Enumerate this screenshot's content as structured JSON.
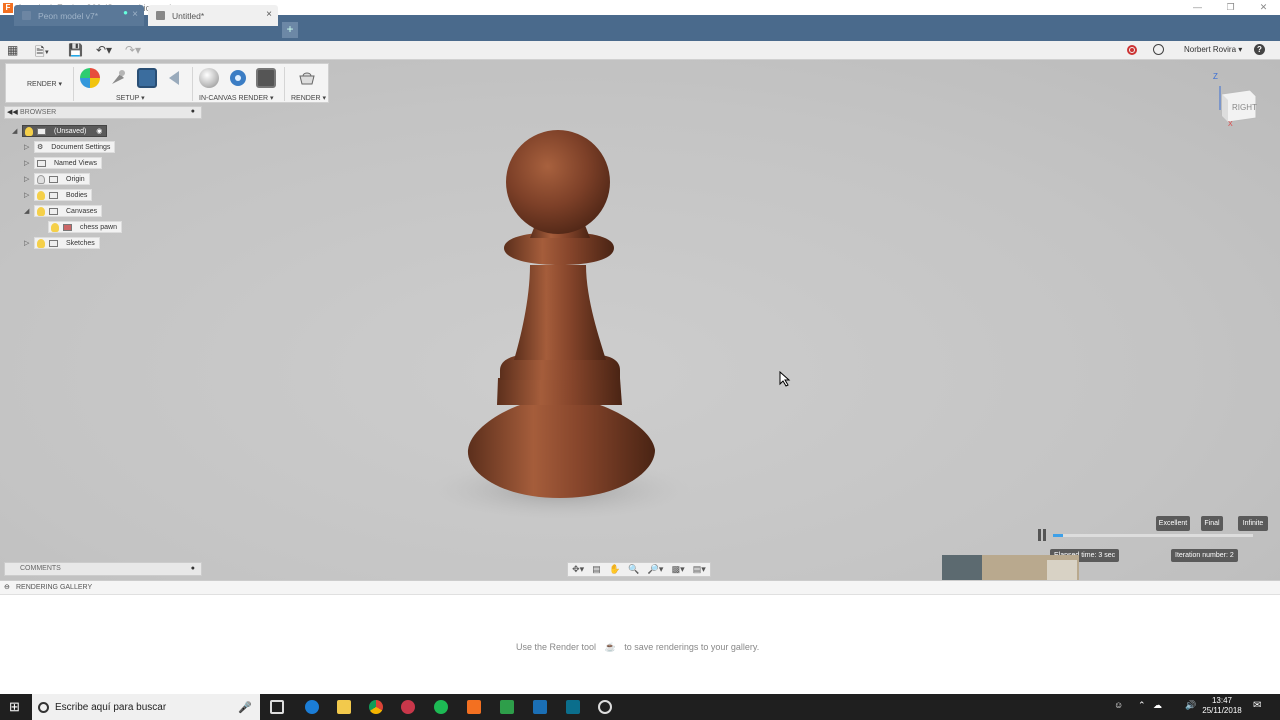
{
  "window": {
    "title": "Autodesk Fusion 360 (Startup License)"
  },
  "tabs": [
    {
      "label": "Peon model v7*"
    },
    {
      "label": "Untitled*"
    }
  ],
  "user": {
    "name": "Norbert Rovira"
  },
  "toolbar": {
    "render_mode": "RENDER",
    "groups": [
      {
        "label": "SETUP"
      },
      {
        "label": "IN-CANVAS RENDER"
      },
      {
        "label": "RENDER"
      }
    ]
  },
  "browser": {
    "title": "BROWSER",
    "root": "(Unsaved)",
    "items": [
      {
        "label": "Document Settings"
      },
      {
        "label": "Named Views"
      },
      {
        "label": "Origin"
      },
      {
        "label": "Bodies"
      },
      {
        "label": "Canvases"
      },
      {
        "label": "chess pawn"
      },
      {
        "label": "Sketches"
      }
    ]
  },
  "viewcube": {
    "face": "RIGHT",
    "axis_z": "Z",
    "axis_x": "X"
  },
  "comments": {
    "title": "COMMENTS"
  },
  "quality": {
    "options": [
      "Excellent",
      "Final",
      "Infinite"
    ],
    "elapsed": "Elapsed time: 3 sec",
    "iteration": "Iteration number: 2",
    "progress": 0.05
  },
  "gallery": {
    "title": "RENDERING GALLERY",
    "message_before": "Use the Render tool",
    "message_after": "to save renderings to your gallery."
  },
  "taskbar": {
    "search_placeholder": "Escribe aquí para buscar",
    "time": "13:47",
    "date": "25/11/2018"
  }
}
